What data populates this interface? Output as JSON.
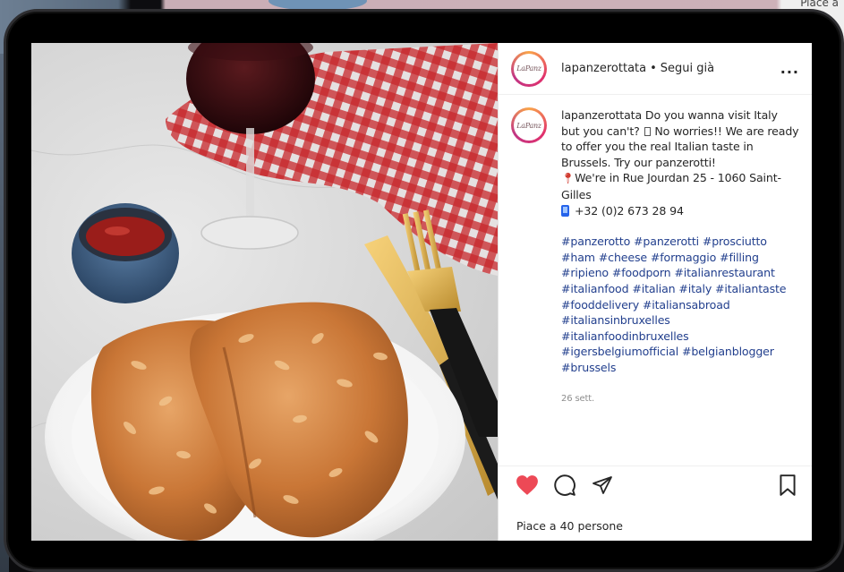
{
  "background": {
    "top_right_text": "Piace a"
  },
  "post": {
    "username": "lapanzerottata",
    "separator": "•",
    "follow_status": "Segui già",
    "more_label": "...",
    "avatar_text": "LaPanz",
    "caption": {
      "username": "lapanzerottata",
      "line1_before_glyph": "Do you wanna visit Italy but you can't?",
      "line1_after_glyph": "No worries!! We are ready to offer you the real Italian taste in Brussels. Try our panzerotti!",
      "address": "We're in Rue Jourdan 25 - 1060 Saint-Gilles",
      "phone": "+32 (0)2 673 28 94",
      "hashtags": [
        "#panzerotto",
        "#panzerotti",
        "#prosciutto",
        "#ham",
        "#cheese",
        "#formaggio",
        "#filling",
        "#ripieno",
        "#foodporn",
        "#italianrestaurant",
        "#italianfood",
        "#italian",
        "#italy",
        "#italiantaste",
        "#fooddelivery",
        "#italiansabroad",
        "#italiansinbruxelles",
        "#italianfoodinbruxelles",
        "#igersbelgiumofficial",
        "#belgianblogger",
        "#brussels"
      ],
      "timestamp": "26 sett."
    },
    "likes_text": "Piace a 40 persone",
    "icons": {
      "like": "heart-icon",
      "comment": "comment-icon",
      "share": "share-icon",
      "save": "bookmark-icon",
      "pin": "pin-icon",
      "phone": "phone-icon"
    },
    "colors": {
      "like_red": "#ed4956",
      "hashtag_blue": "#23408e",
      "text": "#262626",
      "muted": "#8e8e8e"
    }
  }
}
